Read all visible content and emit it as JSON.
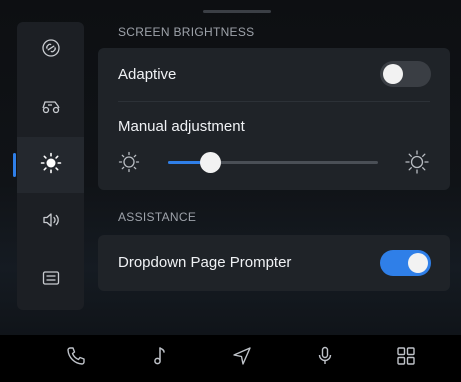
{
  "nav_rail": [
    {
      "icon": "link-icon",
      "active": false
    },
    {
      "icon": "car-icon",
      "active": false
    },
    {
      "icon": "brightness-icon",
      "active": true
    },
    {
      "icon": "speaker-icon",
      "active": false
    },
    {
      "icon": "keyboard-icon",
      "active": false
    }
  ],
  "brightness_section": {
    "title": "SCREEN BRIGHTNESS",
    "adaptive_label": "Adaptive",
    "adaptive_on": false,
    "manual_label": "Manual adjustment",
    "manual_level": 0.2
  },
  "assistance_section": {
    "title": "ASSISTANCE",
    "prompter_label": "Dropdown Page Prompter",
    "prompter_on": true
  },
  "dock": [
    "phone-icon",
    "music-icon",
    "navigation-icon",
    "microphone-icon",
    "apps-grid-icon"
  ],
  "colors": {
    "accent": "#2f7fe8",
    "card": "#1f2328",
    "background": "#0d0f12"
  }
}
